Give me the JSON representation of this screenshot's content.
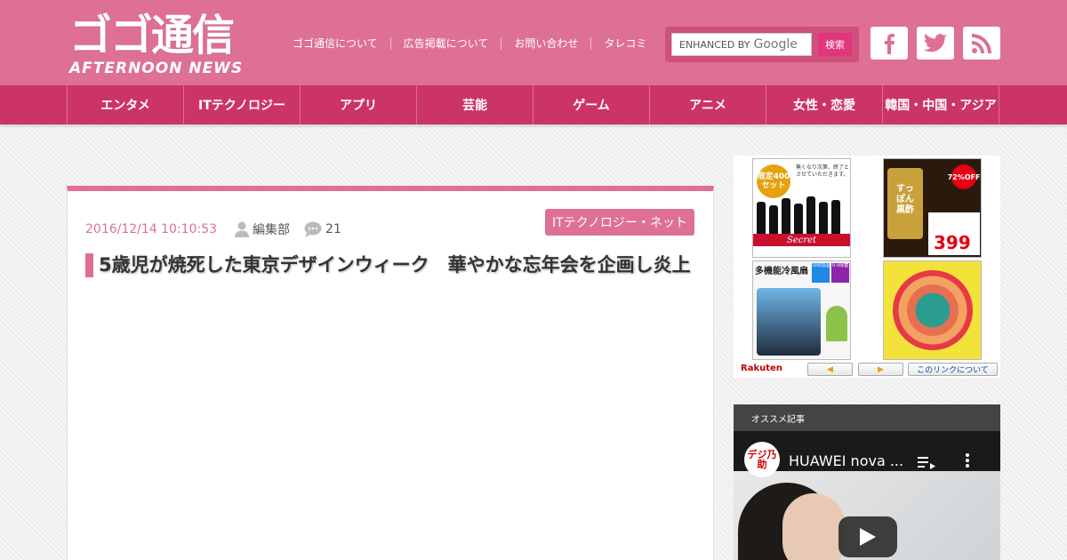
{
  "site": {
    "logo_main": "ゴゴ通信",
    "logo_sub": "AFTERNOON NEWS"
  },
  "top_links": [
    "ゴゴ通信について",
    "広告掲載について",
    "お問い合わせ",
    "タレコミ"
  ],
  "search": {
    "label": "ENHANCED BY",
    "brand": "Google",
    "button": "検索"
  },
  "social": [
    "facebook-icon",
    "twitter-icon",
    "rss-icon"
  ],
  "nav": [
    "エンタメ",
    "ITテクノロジー",
    "アプリ",
    "芸能",
    "ゲーム",
    "アニメ",
    "女性・恋愛",
    "韓国・中国・アジア"
  ],
  "article": {
    "date": "2016/12/14 10:10:53",
    "author": "編集部",
    "comments": "21",
    "category": "ITテクノロジー・ネット",
    "title": "5歳児が焼死した東京デザインウィーク　華やかな忘年会を企画し炎上"
  },
  "ad": {
    "items": [
      {
        "badge": "限定400セット",
        "text": "無くなり次第、終了とさせていただきます。",
        "label": "Secret"
      },
      {
        "badge": "72%OFF",
        "text": "すっぽん黒酢",
        "price": "399"
      },
      {
        "badge": "多機能冷風扇",
        "tags": [
          "冷却加湿",
          "U-V除菌"
        ]
      },
      {
        "badge": ""
      }
    ],
    "rakuten": "Rakuten",
    "prev": "◀",
    "next": "▶",
    "about": "このリンクについて"
  },
  "recommend": {
    "heading": "オススメ記事",
    "channel": "デジ乃助",
    "video_title": "HUAWEI nova ..."
  },
  "colors": {
    "header": "#de7095",
    "nav": "#cc3465",
    "accent": "#de7095"
  }
}
